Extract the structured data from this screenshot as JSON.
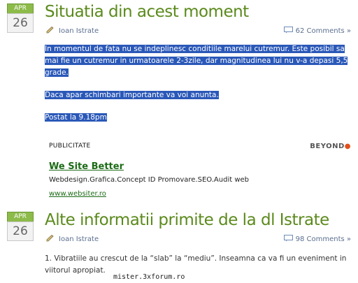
{
  "posts": [
    {
      "month": "APR",
      "day": "26",
      "title": "Situatia din acest moment",
      "author": "Ioan Istrate",
      "comments": "62 Comments »",
      "paragraphs": [
        "In momentul de fata nu se indeplinesc conditiile marelui cutremur. Este posibil sa mai fie un cutremur in urmatoarele 2-3zile, dar magnitudinea lui nu v-a depasi 5,5 grade.",
        "Daca apar schimbari importante va voi anunta.",
        "Postat la 9.18pm"
      ]
    },
    {
      "month": "APR",
      "day": "26",
      "title": "Alte informatii primite de la dl Istrate",
      "author": "Ioan Istrate",
      "comments": "98 Comments »",
      "paragraphs": [
        "1. Vibratiile au crescut de la “slab” la “mediu”.  Inseamna ca va fi un eveniment in viitorul apropiat."
      ]
    }
  ],
  "ad": {
    "label": "PUBLICITATE",
    "brand": "BEYOND",
    "brand_dot": "●",
    "link": "We Site Better",
    "description": "Webdesign.Grafica.Concept ID Promovare.SEO.Audit web",
    "url": "www.websiter.ro"
  },
  "watermark": "mister.3xforum.ro",
  "colors": {
    "accent": "#5b8a1c",
    "selection": "#2a58b8",
    "date_tab": "#8dbb4a"
  }
}
